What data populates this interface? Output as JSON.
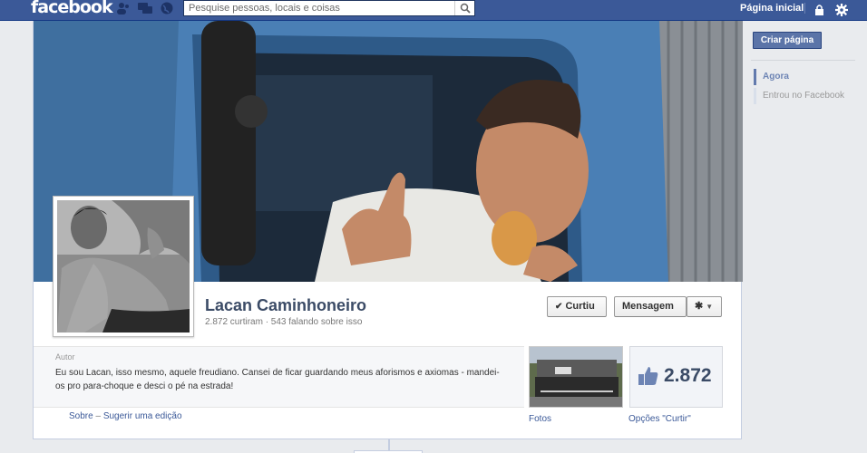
{
  "topbar": {
    "logo": "facebook",
    "search_placeholder": "Pesquise pessoas, locais e coisas",
    "home_link": "Página inicial",
    "icons": [
      "friends-icon",
      "messages-icon",
      "globe-icon",
      "search-icon",
      "lock-icon",
      "gear-icon"
    ]
  },
  "page": {
    "name": "Lacan Caminhoneiro",
    "stats": "2.872 curtiram · 543 falando sobre isso",
    "like_button": "Curtiu",
    "message_button": "Mensagem"
  },
  "about": {
    "label": "Autor",
    "text": "Eu sou Lacan, isso mesmo, aquele freudiano. Cansei de ficar guardando meus aforismos e axiomas - mandei-os pro para-choque e desci o pé na estrada!",
    "link_about": "Sobre",
    "link_separator": "–",
    "link_edit": "Sugerir uma edição"
  },
  "apps": {
    "photos_label": "Fotos",
    "likes_count": "2.872",
    "likes_label": "Opções \"Curtir\""
  },
  "rail": {
    "create_page": "Criar página",
    "now": "Agora",
    "joined": "Entrou no Facebook"
  },
  "colors": {
    "brand": "#3b5998",
    "link": "#3b5998",
    "background": "#e9ebee"
  }
}
